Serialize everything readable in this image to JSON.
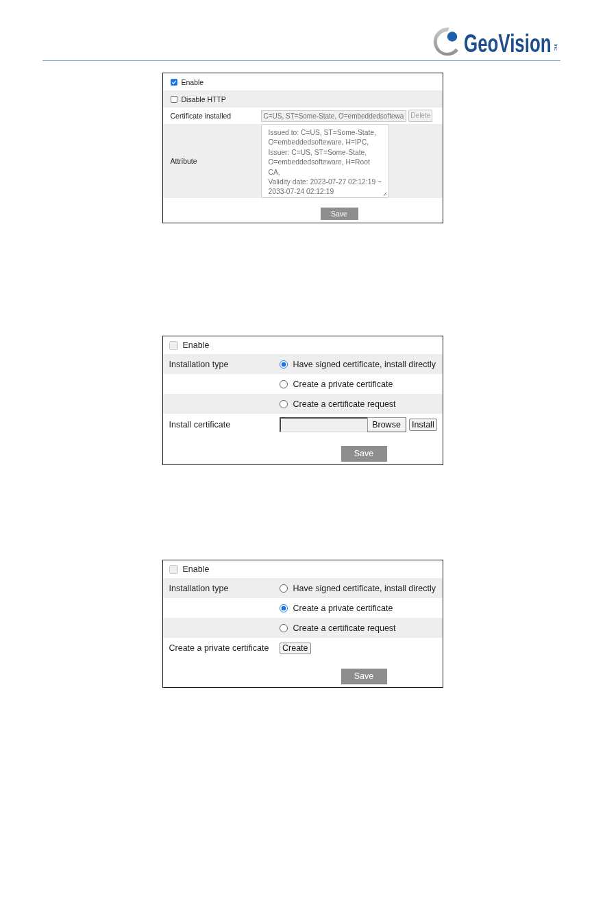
{
  "header": {
    "logo": {
      "text": "GeoVision",
      "suffix": "inc"
    }
  },
  "panels": [
    {
      "rows": [
        {
          "kind": "checkbox",
          "label": "Enable",
          "checked": true,
          "disabled": false
        },
        {
          "kind": "checkbox",
          "label": "Disable HTTP",
          "checked": false,
          "disabled": false
        },
        {
          "kind": "field",
          "label": "Certificate installed",
          "value": "C=US, ST=Some-State, O=embeddedsoftewa",
          "button": "Delete",
          "disabled": true
        },
        {
          "kind": "textarea",
          "label": "Attribute",
          "lines": [
            "Issued to: C=US, ST=Some-State,",
            "O=embeddedsofteware, H=IPC,",
            "Issuer: C=US, ST=Some-State,",
            "O=embeddedsofteware, H=Root",
            "CA,",
            "Validity date: 2023-07-27 02:12:19 ~",
            "2033-07-24 02:12:19"
          ]
        }
      ],
      "save": "Save"
    },
    {
      "rows": [
        {
          "kind": "checkbox",
          "label": "Enable",
          "checked": false,
          "disabled": true
        },
        {
          "kind": "radio",
          "label": "Installation type",
          "option": "Have signed certificate, install directly",
          "selected": true
        },
        {
          "kind": "radio",
          "option": "Create a private certificate",
          "selected": false
        },
        {
          "kind": "radio",
          "option": "Create a certificate request",
          "selected": false
        },
        {
          "kind": "file",
          "label": "Install certificate",
          "browse": "Browse",
          "button": "Install"
        }
      ],
      "save": "Save"
    },
    {
      "rows": [
        {
          "kind": "checkbox",
          "label": "Enable",
          "checked": false,
          "disabled": true
        },
        {
          "kind": "radio",
          "label": "Installation type",
          "option": "Have signed certificate, install directly",
          "selected": false
        },
        {
          "kind": "radio",
          "option": "Create a private certificate",
          "selected": true
        },
        {
          "kind": "radio",
          "option": "Create a certificate request",
          "selected": false
        },
        {
          "kind": "button",
          "label": "Create a private certificate",
          "button": "Create"
        }
      ],
      "save": "Save"
    }
  ]
}
